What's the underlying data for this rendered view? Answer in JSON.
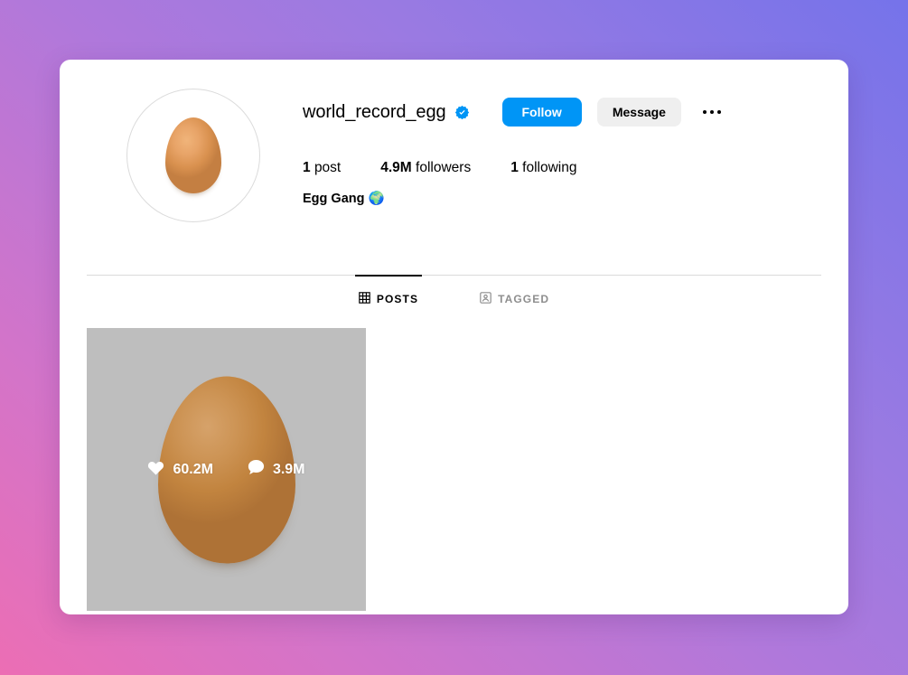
{
  "background": {
    "gradient_from": "#ec6eb4",
    "gradient_mid": "#b078db",
    "gradient_to": "#7573ea"
  },
  "profile": {
    "username": "world_record_egg",
    "verified": true,
    "verified_icon": "verified-badge-icon",
    "avatar_icon": "egg-avatar-image",
    "bio_text": "Egg Gang",
    "bio_emoji": "🌍",
    "accent_color": "#0095f6"
  },
  "actions": {
    "follow_label": "Follow",
    "message_label": "Message",
    "options_icon": "more-options-icon"
  },
  "stats": [
    {
      "value": "1",
      "label": "post"
    },
    {
      "value": "4.9M",
      "label": "followers"
    },
    {
      "value": "1",
      "label": "following"
    }
  ],
  "tabs": [
    {
      "label": "POSTS",
      "icon": "grid-icon",
      "active": true
    },
    {
      "label": "TAGGED",
      "icon": "tagged-person-icon",
      "active": false
    }
  ],
  "posts": [
    {
      "image": "egg-photo",
      "likes": "60.2M",
      "comments": "3.9M",
      "like_icon": "heart-icon",
      "comment_icon": "comment-bubble-icon"
    }
  ]
}
